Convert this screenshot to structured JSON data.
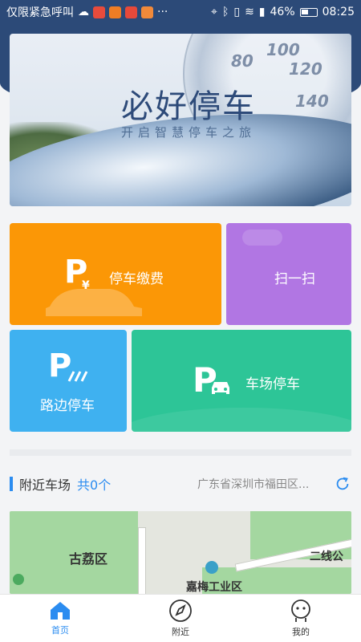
{
  "status_bar": {
    "carrier": "仅限紧急呼叫",
    "dots": "···",
    "battery": "46%",
    "time": "08:25"
  },
  "banner": {
    "title": "必好停车",
    "subtitle": "开启智慧停车之旅",
    "speed_marks": [
      "80",
      "100",
      "120",
      "140"
    ]
  },
  "tiles": {
    "pay": {
      "label": "停车缴费",
      "icon_letter": "P",
      "icon_sub": "¥"
    },
    "scan": {
      "label": "扫一扫"
    },
    "road": {
      "label": "路边停车",
      "icon_letter": "P"
    },
    "lot": {
      "label": "车场停车",
      "icon_letter": "P"
    }
  },
  "nearby": {
    "title": "附近车场",
    "count": "共0个",
    "location": "广东省深圳市福田区..."
  },
  "map": {
    "labels": [
      "古荔区",
      "嘉梅工业区",
      "二线公"
    ]
  },
  "tabbar": {
    "items": [
      {
        "label": "首页",
        "icon": "home-icon",
        "active": true
      },
      {
        "label": "附近",
        "icon": "compass-icon",
        "active": false
      },
      {
        "label": "我的",
        "icon": "profile-icon",
        "active": false
      }
    ]
  },
  "colors": {
    "header": "#2c4a78",
    "pay": "#fb9706",
    "scan": "#b176e3",
    "road": "#3fb1f0",
    "lot": "#2dc597",
    "accent": "#2b8cf0"
  }
}
